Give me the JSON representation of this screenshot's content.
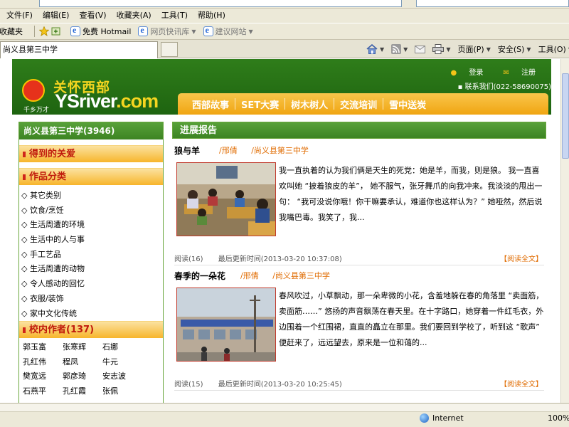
{
  "browser": {
    "menu": [
      "文件(F)",
      "编辑(E)",
      "查看(V)",
      "收藏夹(A)",
      "工具(T)",
      "帮助(H)"
    ],
    "favorites_label": "收藏夹",
    "fav_links": [
      "免费 Hotmail",
      "网页快讯库",
      "建议网站"
    ],
    "tab_title": "尚义县第三中学",
    "commands": {
      "page": "页面(P)",
      "safety": "安全(S)",
      "tools": "工具(O)"
    },
    "status": {
      "zone": "Internet",
      "zoom": "100%"
    }
  },
  "site": {
    "logo_cn": "关怀西部",
    "logo_en_main": "YSriver",
    "logo_en_tail": ".com",
    "logo_sub": "千乡万才",
    "login": "登录",
    "register": "注册",
    "contact": "联系我们(022-58690075)",
    "nav": [
      "西部故事",
      "SET大赛",
      "树木树人",
      "交流培训",
      "雪中送炭"
    ]
  },
  "sidebar": {
    "school_title": "尚义县第三中学(3946)",
    "care_title": "得到的关爱",
    "works_title": "作品分类",
    "categories": [
      "◇ 其它类别",
      "◇ 饮食/烹饪",
      "◇ 生活周遭的环境",
      "◇ 生活中的人与事",
      "◇ 手工艺品",
      "◇ 生活周遭的动物",
      "◇ 令人感动的回忆",
      "◇ 衣服/装饰",
      "◇ 家中文化传统"
    ],
    "authors_title": "校内作者(137)",
    "authors": [
      "郭玉富",
      "张寒辉",
      "石娜",
      "孔红伟",
      "程凤",
      "牛元",
      "樊宽远",
      "郭彦琦",
      "安志波",
      "石燕平",
      "孔红霞",
      "张佩"
    ]
  },
  "main": {
    "section_title": "进展报告",
    "articles": [
      {
        "title": "狼与羊",
        "author": "/邢倩",
        "school": "/尚义县第三中学",
        "excerpt": "我一直执着的认为我们俩是天生的死党：她是羊，而我，则是狼。 我一直喜欢叫她 “披着狼皮的羊”， 她不服气，张牙舞爪的向我冲来。我淡淡的甩出一句： “我可没说你哦！你干嘛要承认，难道你也这样认为？” 她哑然，然后说我嘴巴毒。我笑了，我...",
        "reads": "阅读(16)",
        "updated": "最后更新时间(2013-03-20 10:37:08)",
        "more": "【阅读全文】"
      },
      {
        "title": "春季的一朵花",
        "author": "/邢倩",
        "school": "/尚义县第三中学",
        "excerpt": "春风吹过，小草飘动，那一朵卑微的小花，含羞地躲在春的角落里 “卖面筋，卖面筋……” 悠扬的声音飘荡在春天里。在十字路口，她穿着一件红毛衣，外边围着一个红围裙，直直的矗立在那里。我们要回到学校了，听到这 “歌声” 便赶来了，远远望去，原来是一位和蔼的...",
        "reads": "阅读(15)",
        "updated": "最后更新时间(2013-03-20 10:25:45)",
        "more": "【阅读全文】"
      }
    ]
  }
}
